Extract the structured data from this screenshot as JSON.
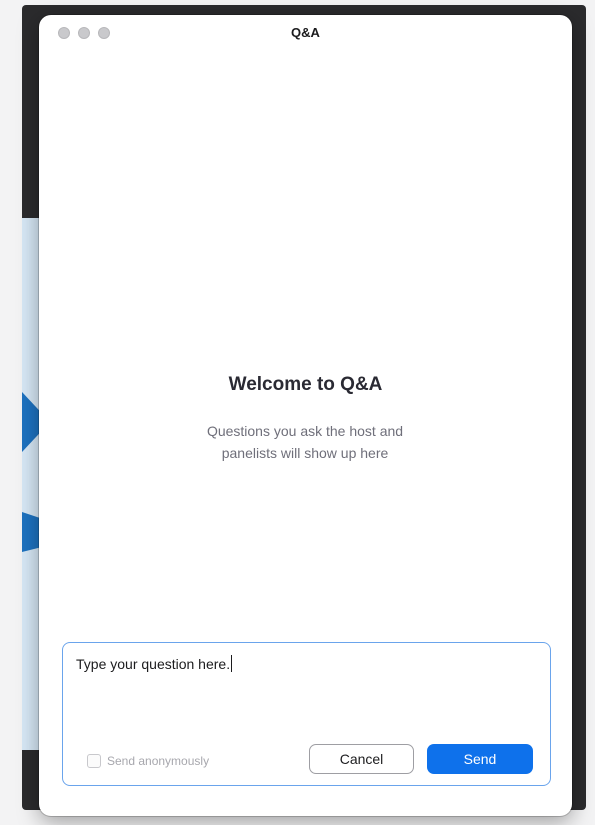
{
  "window": {
    "title": "Q&A"
  },
  "empty_state": {
    "heading": "Welcome to Q&A",
    "line1": "Questions you ask the host and",
    "line2": "panelists will show up here"
  },
  "compose": {
    "input_value": "Type your question here.",
    "anonymous_label": "Send anonymously",
    "anonymous_checked": false,
    "cancel_label": "Cancel",
    "send_label": "Send"
  },
  "colors": {
    "accent": "#0e71eb",
    "input_border": "#6aa4ec",
    "background_app_blue": "#1d72c0"
  },
  "icons": {
    "window_controls": [
      "close-icon",
      "minimize-icon",
      "zoom-icon"
    ]
  }
}
